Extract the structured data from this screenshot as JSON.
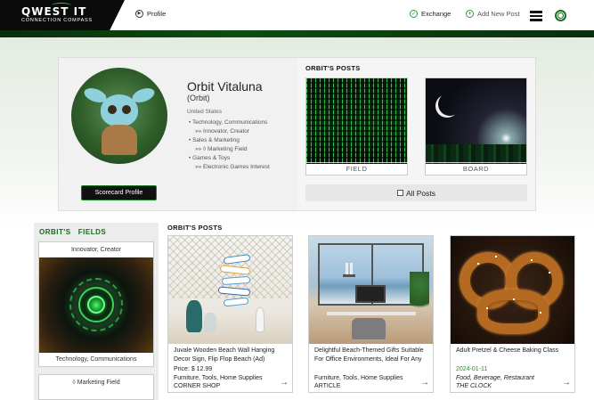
{
  "header": {
    "logo_title": "QWEST IT",
    "logo_subtitle": "CONNECTION COMPASS",
    "nav": {
      "profile": "Profile",
      "exchange": "Exchange",
      "add_post": "Add New Post"
    },
    "icons": {
      "profile": "play-circle-icon",
      "exchange": "check-circle-icon",
      "add_post": "plus-circle-icon",
      "menu": "hamburger-menu-icon",
      "target": "target-icon"
    }
  },
  "profile": {
    "name": "Orbit Vitaluna",
    "handle": "(Orbit)",
    "country": "United States",
    "fields": [
      {
        "industry": "Technology, Communications",
        "sub": "»» Innovator, Creator"
      },
      {
        "industry": "Sales & Marketing",
        "sub": "»» ◊ Marketing Field"
      },
      {
        "industry": "Games & Toys",
        "sub": "»» Electronic Games Interest"
      }
    ],
    "scorecard_button": "Scorecard Profile"
  },
  "profile_posts": {
    "title": "ORBIT'S POSTS",
    "thumbs": [
      {
        "label": "FIELD"
      },
      {
        "label": "BOARD"
      }
    ],
    "all_posts": "All Posts"
  },
  "fields_panel": {
    "title": "ORBIT'S   FIELDS",
    "card": {
      "head": "Innovator, Creator",
      "foot": "Technology, Communications"
    },
    "card2": {
      "head": "◊ Marketing Field"
    }
  },
  "posts": {
    "title": "ORBIT'S POSTS",
    "items": [
      {
        "title": "Juvale Wooden Beach Wall Hanging Decor Sign, Flip Flop Beach (Ad)",
        "price": "Price: $ 12.99",
        "category": "Furniture, Tools, Home Supplies",
        "type": "CORNER SHOP"
      },
      {
        "title": "Delightful Beach-Themed Gifts Suitable For Office Environments, Ideal For Any",
        "category": "Furniture, Tools, Home Supplies",
        "type": "ARTICLE"
      },
      {
        "title": "Adult Pretzel & Cheese Baking Class",
        "date": "2024-01-11",
        "category": "Food, Beverage, Restaurant",
        "type": "THE CLOCK"
      }
    ],
    "arrow": "→"
  }
}
